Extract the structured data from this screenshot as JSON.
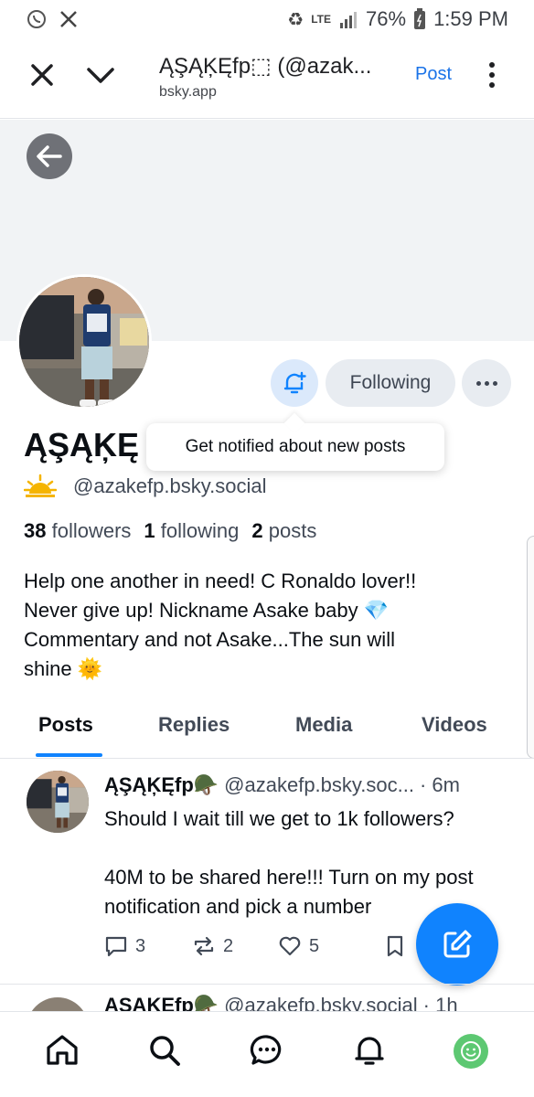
{
  "status_bar": {
    "battery": "76%",
    "time": "1:59 PM",
    "network": "LTE"
  },
  "browser": {
    "title": "ĄŞĄĶĘfp⬚ (@azak...",
    "url": "bsky.app",
    "action_label": "Post"
  },
  "profile": {
    "display_name": "ĄŞĄĶĘ",
    "handle": "@azakefp.bsky.social",
    "following_label": "Following",
    "tooltip": "Get notified about new posts",
    "followers_count": "38",
    "followers_label": "followers",
    "following_count": "1",
    "following_stat_label": "following",
    "posts_count": "2",
    "posts_label": "posts",
    "bio_lines": [
      "Help one another in need! C Ronaldo lover!!",
      "Never give up! Nickname Asake baby 💎",
      "Commentary and not Asake...The sun will",
      "shine 🌞"
    ]
  },
  "tabs": [
    {
      "label": "Posts",
      "active": true
    },
    {
      "label": "Replies",
      "active": false
    },
    {
      "label": "Media",
      "active": false
    },
    {
      "label": "Videos",
      "active": false
    }
  ],
  "posts": [
    {
      "name": "ĄŞĄĶĘfp🪖",
      "handle": "@azakefp.bsky.soc...",
      "time": "· 6m",
      "text_1": "Should I wait till we get to 1k followers?",
      "text_2": "40M to be shared here!!! Turn on my post notification and pick a number",
      "replies": "3",
      "reposts": "2",
      "likes": "5"
    },
    {
      "name": "ĄŞĄĶĘfp🪖",
      "handle": "@azakefp.bsky.social",
      "time": "· 1h"
    }
  ],
  "colors": {
    "accent": "#1083fe",
    "muted_text": "#424a57",
    "banner": "#f1f3f5"
  },
  "icons": [
    "whatsapp-icon",
    "x-icon",
    "close-icon",
    "chevron-down-icon",
    "kebab-icon",
    "back-arrow-icon",
    "bell-plus-icon",
    "sun-icon",
    "reply-icon",
    "repost-icon",
    "like-icon",
    "bookmark-icon",
    "compose-icon",
    "home-icon",
    "search-icon",
    "chat-icon",
    "notifications-icon"
  ]
}
